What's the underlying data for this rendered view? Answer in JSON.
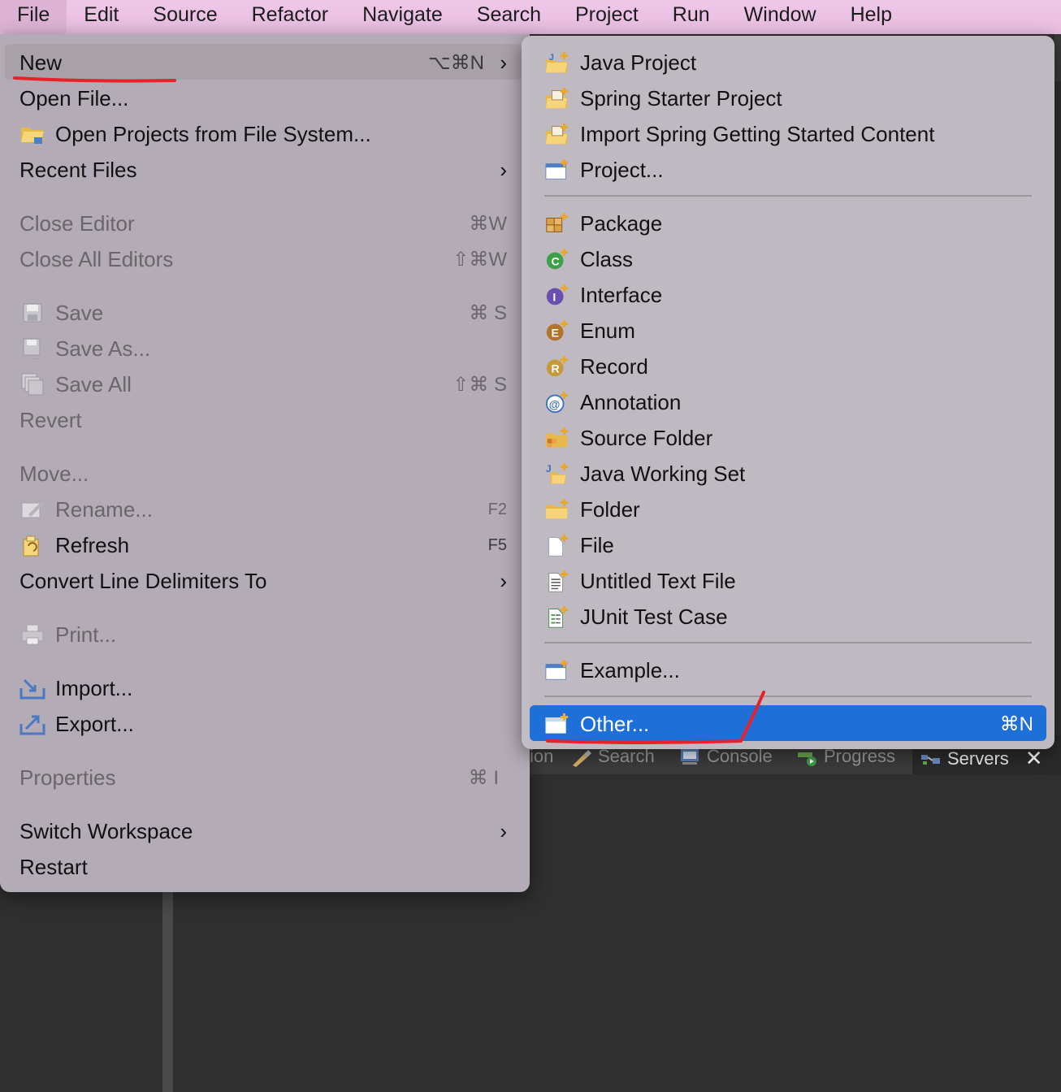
{
  "menubar": {
    "items": [
      "File",
      "Edit",
      "Source",
      "Refactor",
      "Navigate",
      "Search",
      "Project",
      "Run",
      "Window",
      "Help"
    ]
  },
  "file_menu": {
    "new": {
      "label": "New",
      "shortcut": "⌥⌘N",
      "arrow": "›"
    },
    "open_file": {
      "label": "Open File..."
    },
    "open_projects": {
      "label": "Open Projects from File System..."
    },
    "recent_files": {
      "label": "Recent Files",
      "arrow": "›"
    },
    "close_editor": {
      "label": "Close Editor",
      "shortcut": "⌘W"
    },
    "close_all": {
      "label": "Close All Editors",
      "shortcut": "⇧⌘W"
    },
    "save": {
      "label": "Save",
      "shortcut": "⌘ S"
    },
    "save_as": {
      "label": "Save As..."
    },
    "save_all": {
      "label": "Save All",
      "shortcut": "⇧⌘ S"
    },
    "revert": {
      "label": "Revert"
    },
    "move": {
      "label": "Move..."
    },
    "rename": {
      "label": "Rename...",
      "shortcut": "F2"
    },
    "refresh": {
      "label": "Refresh",
      "shortcut": "F5"
    },
    "convert": {
      "label": "Convert Line Delimiters To",
      "arrow": "›"
    },
    "print": {
      "label": "Print..."
    },
    "import": {
      "label": "Import..."
    },
    "export": {
      "label": "Export..."
    },
    "properties": {
      "label": "Properties",
      "shortcut": "⌘ I"
    },
    "switch_ws": {
      "label": "Switch Workspace",
      "arrow": "›"
    },
    "restart": {
      "label": "Restart"
    }
  },
  "new_submenu": {
    "java_project": "Java Project",
    "spring_starter": "Spring Starter Project",
    "import_spring": "Import Spring Getting Started Content",
    "project": "Project...",
    "package": "Package",
    "class": "Class",
    "interface": "Interface",
    "enum": "Enum",
    "record": "Record",
    "annotation": "Annotation",
    "source_folder": "Source Folder",
    "java_working_set": "Java Working Set",
    "folder": "Folder",
    "file": "File",
    "untitled_text": "Untitled Text File",
    "junit": "JUnit Test Case",
    "example": "Example...",
    "other": {
      "label": "Other...",
      "shortcut": "⌘N"
    }
  },
  "bottom_tabs": {
    "partial": "ion",
    "search": "Search",
    "console": "Console",
    "progress": "Progress",
    "servers": "Servers",
    "close": "✕"
  },
  "colors": {
    "menubar": "#efc7e8",
    "menu_bg": "#b8b0ba",
    "selection": "#1f6fd8",
    "annotation": "#e8222a"
  }
}
